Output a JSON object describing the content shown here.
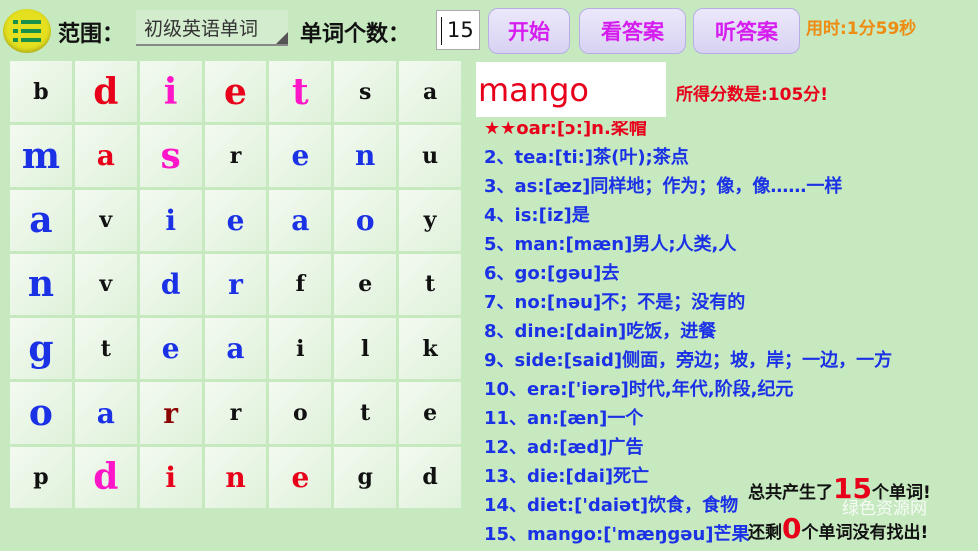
{
  "header": {
    "range_label": "范围：",
    "range_value": "初级英语单词",
    "count_label": "单词个数：",
    "count_value": "15",
    "start_button": "开始",
    "show_answer_button": "看答案",
    "listen_answer_button": "听答案",
    "timer": "用时:1分59秒"
  },
  "colors": {
    "background": "#c6e9c0",
    "red": "#e8001a",
    "magenta": "#ff16c8",
    "blue": "#1b31e6",
    "dark": "#111111",
    "darkred": "#8b0000",
    "button_text": "#d61df0",
    "timer": "#ee8c12"
  },
  "grid": {
    "rows": [
      [
        {
          "ch": "b",
          "c": "dark",
          "s": "s"
        },
        {
          "ch": "d",
          "c": "red",
          "s": "l"
        },
        {
          "ch": "i",
          "c": "magenta",
          "s": "l"
        },
        {
          "ch": "e",
          "c": "red",
          "s": "l"
        },
        {
          "ch": "t",
          "c": "magenta",
          "s": "l"
        },
        {
          "ch": "s",
          "c": "dark",
          "s": "s"
        },
        {
          "ch": "a",
          "c": "dark",
          "s": "s"
        }
      ],
      [
        {
          "ch": "m",
          "c": "blue",
          "s": "l"
        },
        {
          "ch": "a",
          "c": "red",
          "s": "m"
        },
        {
          "ch": "s",
          "c": "magenta",
          "s": "l"
        },
        {
          "ch": "r",
          "c": "dark",
          "s": "s"
        },
        {
          "ch": "e",
          "c": "blue",
          "s": "m"
        },
        {
          "ch": "n",
          "c": "blue",
          "s": "m"
        },
        {
          "ch": "u",
          "c": "dark",
          "s": "s"
        }
      ],
      [
        {
          "ch": "a",
          "c": "blue",
          "s": "l"
        },
        {
          "ch": "v",
          "c": "dark",
          "s": "s"
        },
        {
          "ch": "i",
          "c": "blue",
          "s": "m"
        },
        {
          "ch": "e",
          "c": "blue",
          "s": "m"
        },
        {
          "ch": "a",
          "c": "blue",
          "s": "m"
        },
        {
          "ch": "o",
          "c": "blue",
          "s": "m"
        },
        {
          "ch": "y",
          "c": "dark",
          "s": "s"
        }
      ],
      [
        {
          "ch": "n",
          "c": "blue",
          "s": "l"
        },
        {
          "ch": "v",
          "c": "dark",
          "s": "s"
        },
        {
          "ch": "d",
          "c": "blue",
          "s": "m"
        },
        {
          "ch": "r",
          "c": "blue",
          "s": "m"
        },
        {
          "ch": "f",
          "c": "dark",
          "s": "s"
        },
        {
          "ch": "e",
          "c": "dark",
          "s": "s"
        },
        {
          "ch": "t",
          "c": "dark",
          "s": "s"
        }
      ],
      [
        {
          "ch": "g",
          "c": "blue",
          "s": "l"
        },
        {
          "ch": "t",
          "c": "dark",
          "s": "s"
        },
        {
          "ch": "e",
          "c": "blue",
          "s": "m"
        },
        {
          "ch": "a",
          "c": "blue",
          "s": "m"
        },
        {
          "ch": "i",
          "c": "dark",
          "s": "s"
        },
        {
          "ch": "l",
          "c": "dark",
          "s": "s"
        },
        {
          "ch": "k",
          "c": "dark",
          "s": "s"
        }
      ],
      [
        {
          "ch": "o",
          "c": "blue",
          "s": "l"
        },
        {
          "ch": "a",
          "c": "blue",
          "s": "m"
        },
        {
          "ch": "r",
          "c": "darkred",
          "s": "m"
        },
        {
          "ch": "r",
          "c": "dark",
          "s": "s"
        },
        {
          "ch": "o",
          "c": "dark",
          "s": "s"
        },
        {
          "ch": "t",
          "c": "dark",
          "s": "s"
        },
        {
          "ch": "e",
          "c": "dark",
          "s": "s"
        }
      ],
      [
        {
          "ch": "p",
          "c": "dark",
          "s": "s"
        },
        {
          "ch": "d",
          "c": "magenta",
          "s": "l"
        },
        {
          "ch": "i",
          "c": "red",
          "s": "m"
        },
        {
          "ch": "n",
          "c": "red",
          "s": "m"
        },
        {
          "ch": "e",
          "c": "red",
          "s": "m"
        },
        {
          "ch": "g",
          "c": "dark",
          "s": "s"
        },
        {
          "ch": "d",
          "c": "dark",
          "s": "s"
        }
      ]
    ]
  },
  "answer": {
    "current_word": "mango",
    "score_text": "所得分数是:105分!"
  },
  "word_list": [
    "★★oar:[ɔ:]n.桨帽",
    "2、tea:[ti:]茶(叶);茶点",
    "3、as:[æz]同样地；作为；像，像……一样",
    "4、is:[iz]是",
    "5、man:[mæn]男人;人类,人",
    "6、go:[gəu]去",
    "7、no:[nəu]不；不是；没有的",
    "8、dine:[dain]吃饭，进餐",
    "9、side:[said]侧面，旁边；坡，岸；一边，一方",
    "10、era:['iərə]时代,年代,阶段,纪元",
    "11、an:[æn]一个",
    "12、ad:[æd]广告",
    "13、die:[dai]死亡",
    "14、diet:['daiət]饮食，食物",
    "15、mango:['mæŋgəu]芒果"
  ],
  "summary": {
    "total_prefix": "总共产生了",
    "total_count": "15",
    "total_suffix": "个单词!",
    "remaining_prefix": "还剩",
    "remaining_count": "0",
    "remaining_suffix": "个单词没有找出!"
  },
  "watermark": "绿色资源网",
  "icons": {
    "menu": "menu-list-icon",
    "dropdown": "dropdown-triangle-icon"
  }
}
